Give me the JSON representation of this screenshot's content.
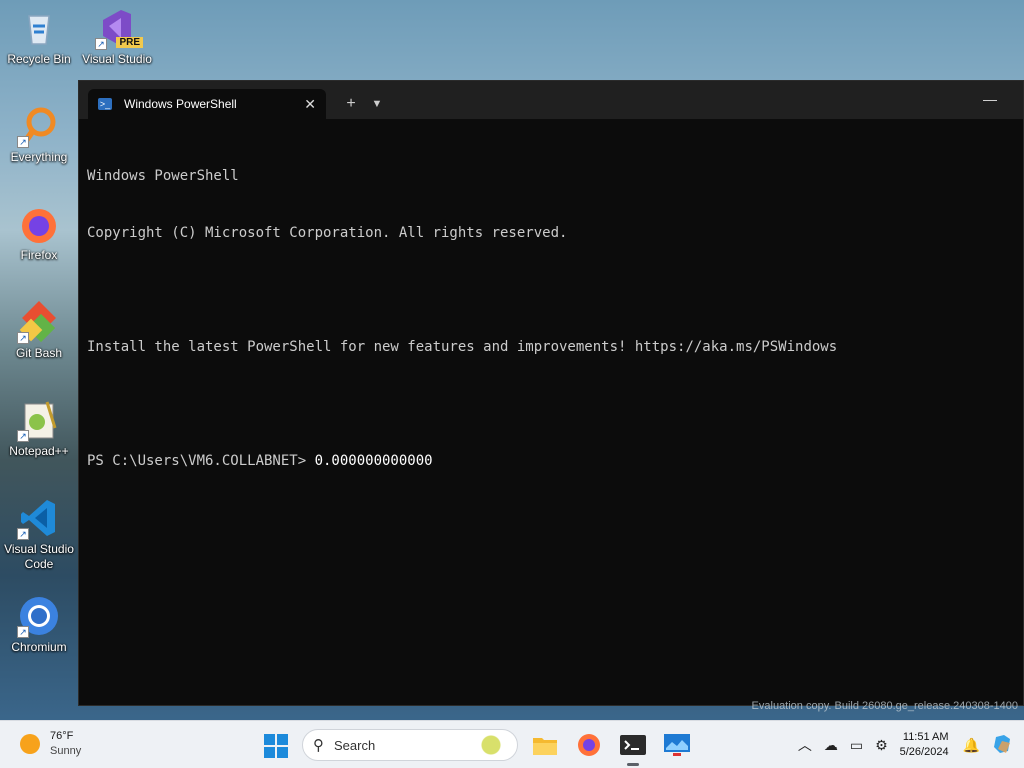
{
  "desktop": {
    "icons": [
      {
        "label": "Recycle Bin"
      },
      {
        "label": "Visual Studio",
        "badge": "PRE"
      },
      {
        "label": "Everything"
      },
      {
        "label": "Firefox"
      },
      {
        "label": "Git Bash"
      },
      {
        "label": "Notepad++"
      },
      {
        "label": "Visual Studio Code"
      },
      {
        "label": "Chromium"
      }
    ]
  },
  "terminal": {
    "tab_title": "Windows PowerShell",
    "lines": [
      "Windows PowerShell",
      "Copyright (C) Microsoft Corporation. All rights reserved.",
      "",
      "Install the latest PowerShell for new features and improvements! https://aka.ms/PSWindows",
      "",
      "PS C:\\Users\\VM6.COLLABNET> "
    ],
    "command": "0.000000000000"
  },
  "watermark": "Evaluation copy. Build 26080.ge_release.240308-1400",
  "taskbar": {
    "weather_temp": "76°F",
    "weather_condition": "Sunny",
    "search_placeholder": "Search",
    "time": "11:51 AM",
    "date": "5/26/2024"
  },
  "colors": {
    "terminal_bg": "#0c0c0c",
    "titlebar_bg": "#202020",
    "taskbar_bg": "#eef1f5",
    "accent": "#1c8adb"
  }
}
